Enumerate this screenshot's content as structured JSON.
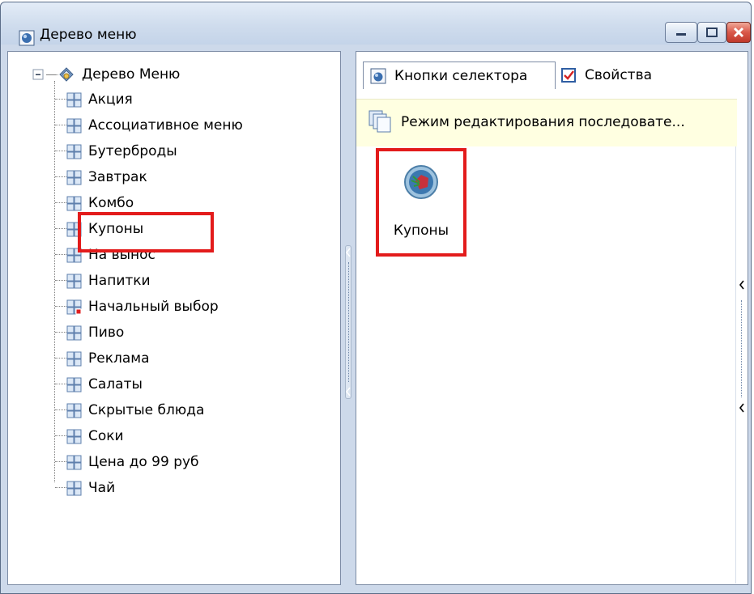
{
  "window": {
    "title": "Дерево меню"
  },
  "tree": {
    "root": "Дерево Меню",
    "items": [
      {
        "label": "Акция"
      },
      {
        "label": "Ассоциативное меню"
      },
      {
        "label": "Бутерброды"
      },
      {
        "label": "Завтрак"
      },
      {
        "label": "Комбо"
      },
      {
        "label": "Купоны",
        "selected": true
      },
      {
        "label": "На вынос"
      },
      {
        "label": "Напитки"
      },
      {
        "label": "Начальный выбор"
      },
      {
        "label": "Пиво"
      },
      {
        "label": "Реклама"
      },
      {
        "label": "Салаты"
      },
      {
        "label": "Скрытые блюда"
      },
      {
        "label": "Соки"
      },
      {
        "label": "Цена до 99 руб"
      },
      {
        "label": "Чай"
      }
    ]
  },
  "tabs": [
    {
      "label": "Кнопки селектора",
      "active": true
    },
    {
      "label": "Свойства",
      "active": false
    }
  ],
  "infobar": {
    "text": "Режим редактирования последовате..."
  },
  "selector": {
    "button_label": "Купоны"
  },
  "colors": {
    "highlight": "#e31b1b",
    "infobar": "#ffffe1",
    "frame": "#cdd9ea"
  }
}
